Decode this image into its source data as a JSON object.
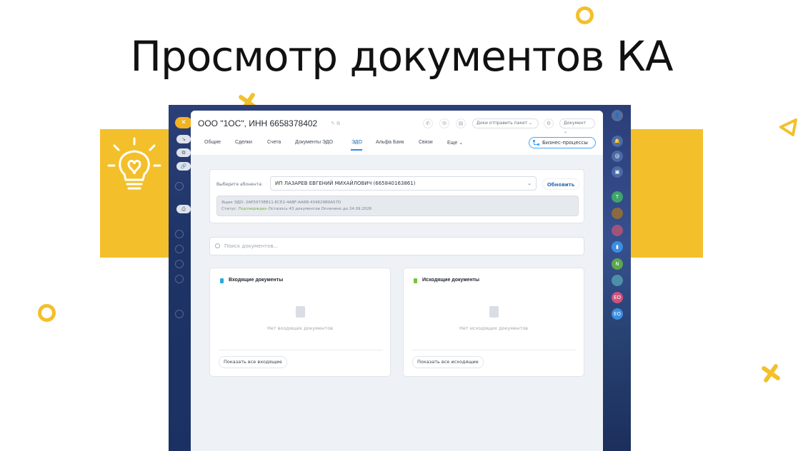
{
  "slide": {
    "title": "Просмотр документов КА",
    "colors": {
      "accent": "#f3c02b",
      "background": "#ffffff"
    }
  },
  "app": {
    "company_title": "ООО \"1ОС\", ИНН 6658378402",
    "header_buttons": {
      "send_package": "Доки отправить пакет",
      "document": "Документ"
    },
    "tabs": [
      {
        "label": "Общие",
        "active": false
      },
      {
        "label": "Сделки",
        "active": false
      },
      {
        "label": "Счета",
        "active": false
      },
      {
        "label": "Документы ЭДО",
        "active": false
      },
      {
        "label": "ЭДО",
        "active": true
      },
      {
        "label": "Альфа Банк",
        "active": false
      },
      {
        "label": "Связи",
        "active": false
      },
      {
        "label": "Еще",
        "active": false
      }
    ],
    "business_processes_label": "Бизнес-процессы",
    "subscriber": {
      "label": "Выберите абонента:",
      "selected": "ИП ЛАЗАРЕВ ЕВГЕНИЙ МИХАЙЛОВИЧ (665840163861)",
      "refresh_label": "Обновить"
    },
    "info": {
      "mailbox_line": "Ящик ЭДО: 2AE5973EB11-ECE2-4ABF-AA6B-434629B9A57D",
      "status_prefix": "Статус:",
      "status_value": "Подтвержден",
      "status_rest": "Осталось 43 документов Оплачено до 24.09.2026"
    },
    "search": {
      "placeholder": "Поиск документов..."
    },
    "incoming": {
      "title": "Входящие документы",
      "empty_text": "Нет входящих документов",
      "show_all": "Показать все входящие"
    },
    "outgoing": {
      "title": "Исходящие документы",
      "empty_text": "Нет исходящих документов",
      "show_all": "Показать все исходящие"
    },
    "right_rail_badges": [
      "T",
      "N",
      "EO",
      "EO"
    ],
    "colors": {
      "active_tab": "#2067b0",
      "status_ok": "#6cb33e",
      "rail_close": "#f3b321",
      "incoming_icon": "#29a9e0",
      "outgoing_icon": "#7ac143"
    }
  }
}
